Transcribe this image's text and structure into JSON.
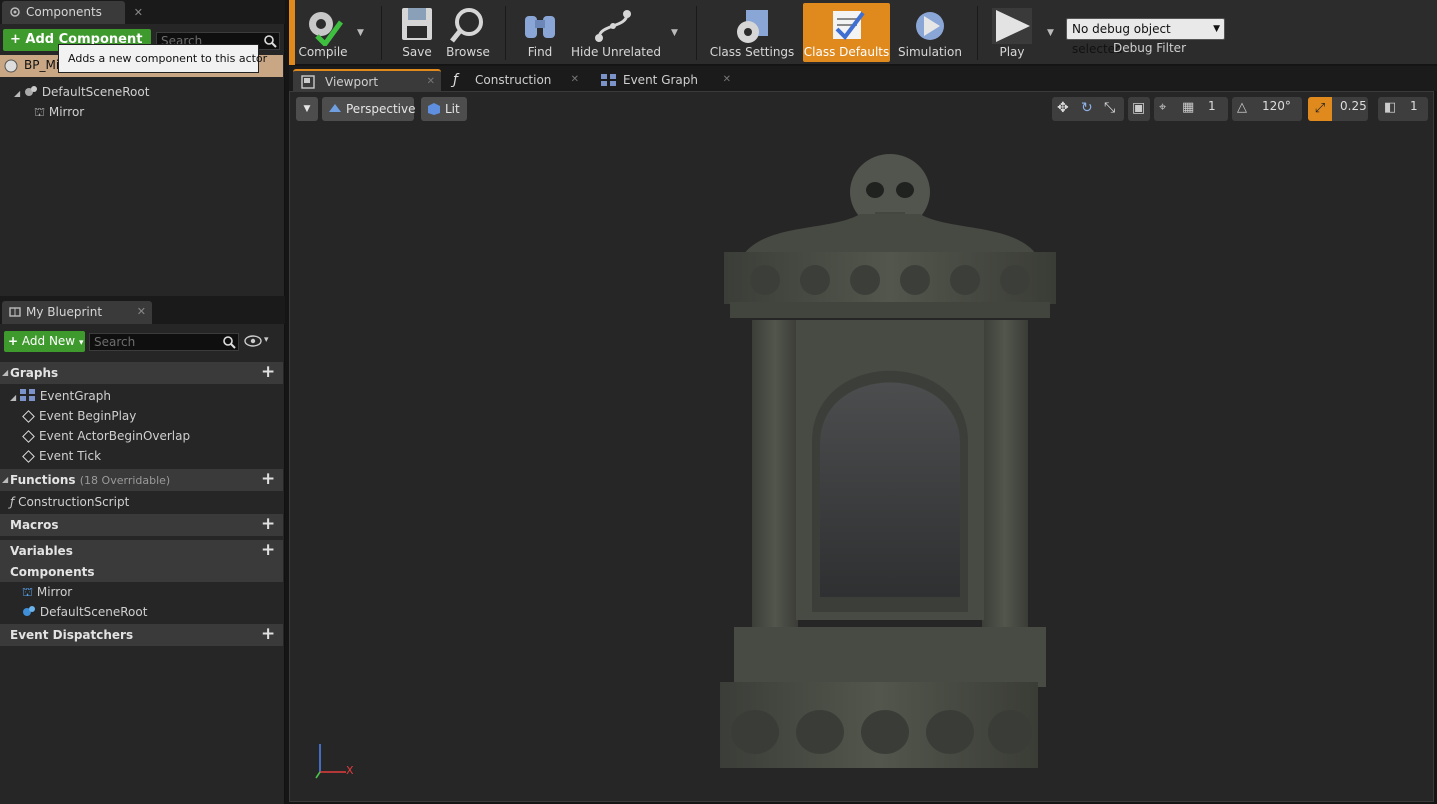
{
  "components_panel": {
    "tab_label": "Components",
    "add_component_label": "+ Add Component",
    "search_placeholder": "Search",
    "tooltip": "Adds a new component to this actor",
    "actor_name": "BP_Mirror",
    "tree": [
      {
        "label": "DefaultSceneRoot"
      },
      {
        "label": "Mirror"
      }
    ]
  },
  "my_blueprint": {
    "tab_label": "My Blueprint",
    "add_new_label": "Add New",
    "search_placeholder": "Search",
    "sections": {
      "graphs": "Graphs",
      "functions": "Functions",
      "functions_overridable": "(18 Overridable)",
      "macros": "Macros",
      "variables": "Variables",
      "components": "Components",
      "event_dispatchers": "Event Dispatchers"
    },
    "graph_items": [
      "EventGraph",
      "Event BeginPlay",
      "Event ActorBeginOverlap",
      "Event Tick"
    ],
    "function_items": [
      "ConstructionScript"
    ],
    "component_items": [
      "Mirror",
      "DefaultSceneRoot"
    ]
  },
  "toolbar": {
    "compile": "Compile",
    "save": "Save",
    "browse": "Browse",
    "find": "Find",
    "hide_unrelated": "Hide Unrelated",
    "class_settings": "Class Settings",
    "class_defaults": "Class Defaults",
    "simulation": "Simulation",
    "play": "Play",
    "debug_select": "No debug object selected",
    "debug_filter": "Debug Filter"
  },
  "doc_tabs": [
    "Viewport",
    "Construction Scrip",
    "Event Graph"
  ],
  "viewport": {
    "perspective": "Perspective",
    "lit": "Lit",
    "fov": "120°",
    "snap_scale": "0.25",
    "camera_speed": "1",
    "axis_x": "X"
  },
  "colors": {
    "accent_orange": "#e08a1e",
    "green_button": "#3f9a2d",
    "panel_bg": "#262626"
  }
}
